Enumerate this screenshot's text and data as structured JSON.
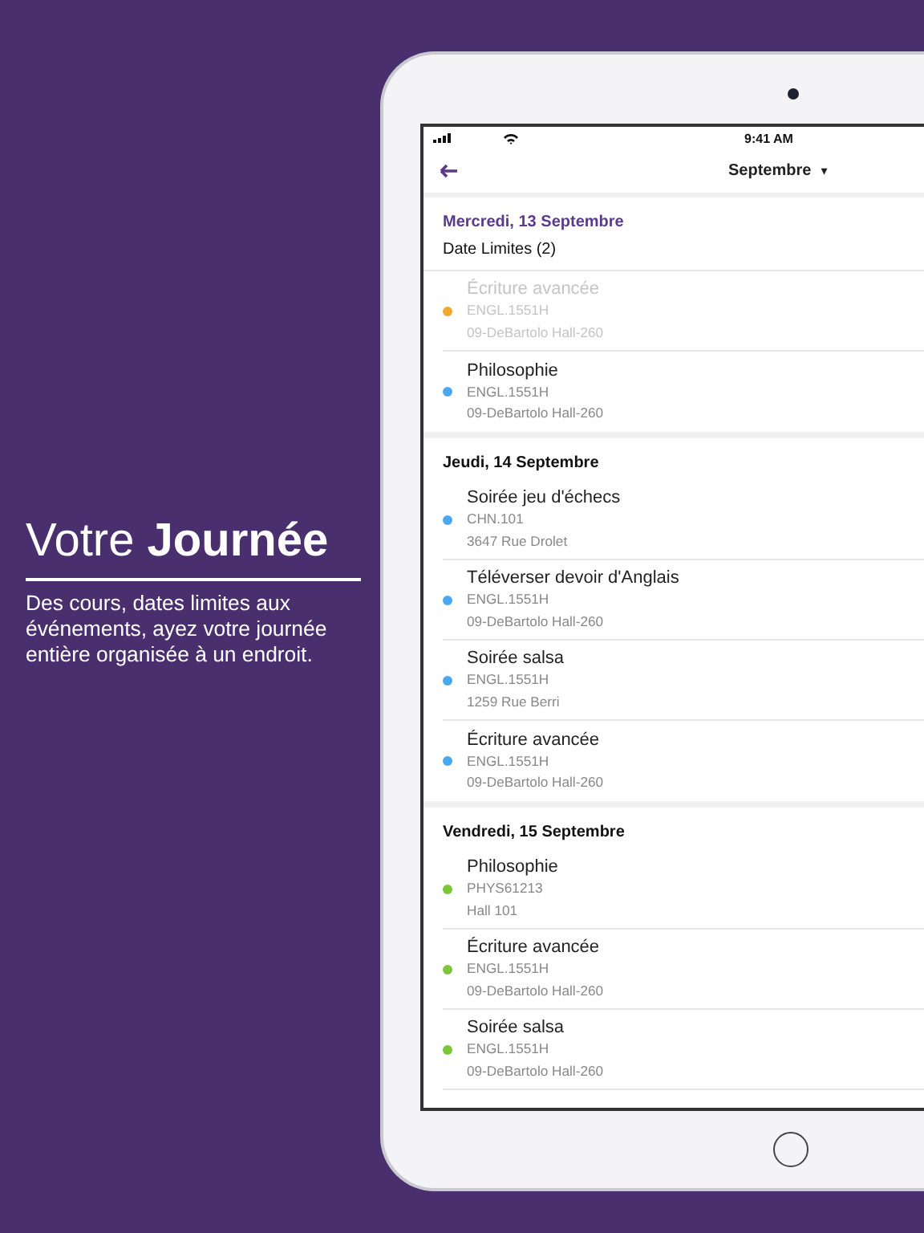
{
  "promo": {
    "headline": "Votre **Journée**",
    "text": "Des cours, dates limites aux événements, ayez votre journée entière organisée à un endroit."
  },
  "status_bar": {
    "time": "9:41 AM"
  },
  "nav": {
    "month": "Septembre",
    "dropdown": "▾"
  },
  "sections": [
    {
      "date": "Mercredi, 13 Septembre",
      "highlighted": true,
      "subtitle": "Date Limites (2)",
      "events": [
        {
          "title": "Écriture avancée",
          "code": "ENGL.1551H",
          "place": "09-DeBartolo Hall-260",
          "color": "#f0a830",
          "disabled": true
        },
        {
          "title": "Philosophie",
          "code": "ENGL.1551H",
          "place": "09-DeBartolo Hall-260",
          "color": "#4aa8ec",
          "disabled": false
        }
      ]
    },
    {
      "date": "Jeudi, 14 Septembre",
      "highlighted": false,
      "events": [
        {
          "title": "Soirée jeu d'échecs",
          "code": "CHN.101",
          "place": "3647 Rue Drolet",
          "color": "#4aa8ec",
          "disabled": false
        },
        {
          "title": "Téléverser devoir d'Anglais",
          "code": "ENGL.1551H",
          "place": "09-DeBartolo Hall-260",
          "color": "#4aa8ec",
          "disabled": false
        },
        {
          "title": "Soirée salsa",
          "code": "ENGL.1551H",
          "place": "1259 Rue Berri",
          "color": "#4aa8ec",
          "disabled": false
        },
        {
          "title": "Écriture avancée",
          "code": "ENGL.1551H",
          "place": "09-DeBartolo Hall-260",
          "color": "#4aa8ec",
          "disabled": false
        }
      ]
    },
    {
      "date": "Vendredi, 15 Septembre",
      "highlighted": false,
      "events": [
        {
          "title": "Philosophie",
          "code": "PHYS61213",
          "place": "Hall 101",
          "color": "#7cc63c",
          "disabled": false
        },
        {
          "title": "Écriture avancée",
          "code": "ENGL.1551H",
          "place": "09-DeBartolo Hall-260",
          "color": "#7cc63c",
          "disabled": false
        },
        {
          "title": "Soirée salsa",
          "code": "ENGL.1551H",
          "place": "09-DeBartolo Hall-260",
          "color": "#7cc63c",
          "disabled": false
        }
      ]
    }
  ]
}
